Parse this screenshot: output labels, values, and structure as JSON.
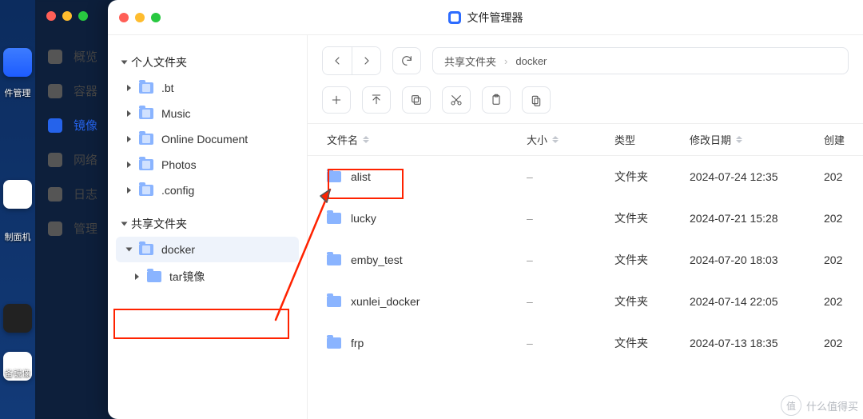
{
  "app": {
    "title": "文件管理器"
  },
  "back_nav": [
    {
      "label": "概览",
      "active": false
    },
    {
      "label": "容器",
      "active": false
    },
    {
      "label": "镜像",
      "active": true
    },
    {
      "label": "网络",
      "active": false
    },
    {
      "label": "日志",
      "active": false
    },
    {
      "label": "管理",
      "active": false
    }
  ],
  "bg_labels": {
    "a": "件管理",
    "b": "制面机",
    "c": "备镜像"
  },
  "sidebar": {
    "personal_label": "个人文件夹",
    "shared_label": "共享文件夹",
    "personal": [
      {
        "label": ".bt"
      },
      {
        "label": "Music"
      },
      {
        "label": "Online Document"
      },
      {
        "label": "Photos"
      },
      {
        "label": ".config"
      }
    ],
    "shared": [
      {
        "label": "docker",
        "selected": true,
        "expanded": true,
        "children": [
          {
            "label": "tar镜像"
          }
        ]
      }
    ]
  },
  "breadcrumb": [
    "共享文件夹",
    "docker"
  ],
  "columns": {
    "name": "文件名",
    "size": "大小",
    "type": "类型",
    "modified": "修改日期",
    "created": "创建"
  },
  "rows": [
    {
      "name": "alist",
      "size": "–",
      "type": "文件夹",
      "modified": "2024-07-24 12:35",
      "created": "202"
    },
    {
      "name": "lucky",
      "size": "–",
      "type": "文件夹",
      "modified": "2024-07-21 15:28",
      "created": "202"
    },
    {
      "name": "emby_test",
      "size": "–",
      "type": "文件夹",
      "modified": "2024-07-20 18:03",
      "created": "202"
    },
    {
      "name": "xunlei_docker",
      "size": "–",
      "type": "文件夹",
      "modified": "2024-07-14 22:05",
      "created": "202"
    },
    {
      "name": "frp",
      "size": "–",
      "type": "文件夹",
      "modified": "2024-07-13 18:35",
      "created": "202"
    }
  ],
  "watermark": {
    "char": "值",
    "text": "什么值得买"
  }
}
